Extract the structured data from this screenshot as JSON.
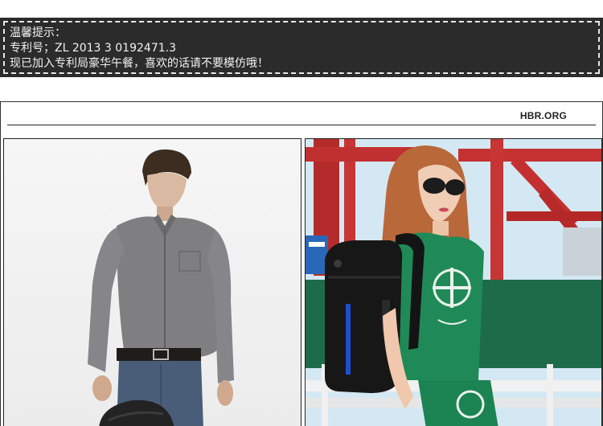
{
  "notice": {
    "lines": [
      "温馨提示：",
      "专利号；ZL 2013 3 0192471.3",
      "现已加入专利局豪华午餐，喜欢的话请不要模仿哦！"
    ]
  },
  "frame": {
    "source": "HBR.ORG"
  },
  "photos": {
    "left": {
      "subject": "man in gray shirt with backpack"
    },
    "right": {
      "subject": "woman in green outfit wearing black backpack"
    }
  },
  "colors": {
    "banner": "#2b2b2b",
    "banner_text": "#f2f2f2",
    "backpack_accent": "#1f4fd1",
    "outfit_green": "#1f8a57"
  }
}
